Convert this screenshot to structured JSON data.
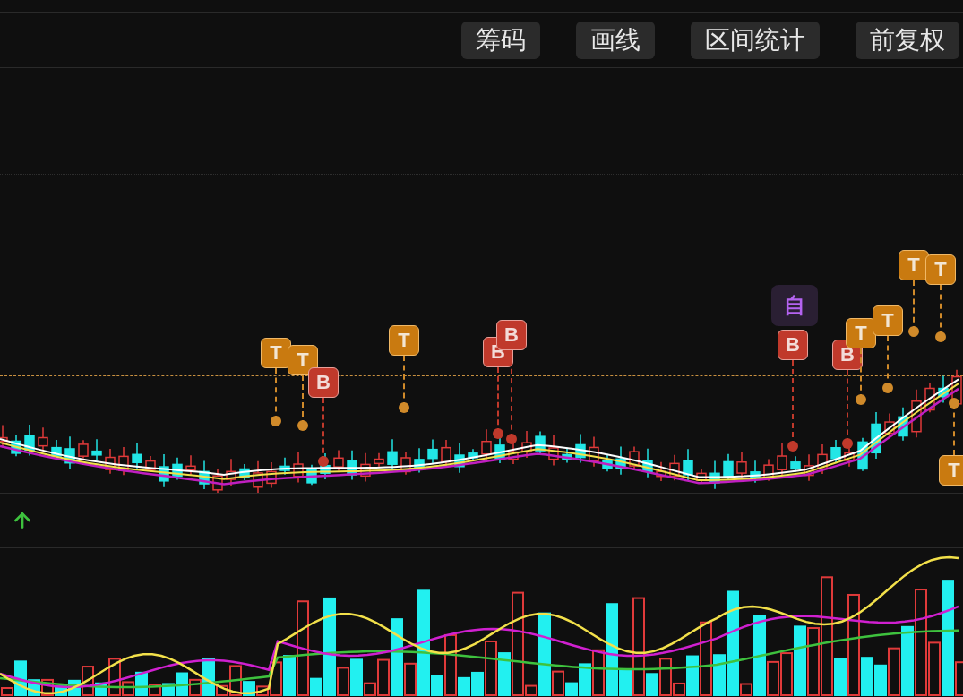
{
  "toolbar": {
    "buttons": [
      "筹码",
      "画线",
      "区间统计",
      "前复权"
    ]
  },
  "markers": [
    {
      "kind": "trade",
      "label": "T"
    },
    {
      "kind": "trade",
      "label": "T"
    },
    {
      "kind": "buy",
      "label": "B"
    },
    {
      "kind": "trade",
      "label": "T"
    },
    {
      "kind": "buy",
      "label": "B"
    },
    {
      "kind": "buy",
      "label": "B"
    },
    {
      "kind": "self",
      "label": "自"
    },
    {
      "kind": "buy",
      "label": "B"
    },
    {
      "kind": "buy",
      "label": "B"
    },
    {
      "kind": "trade",
      "label": "T"
    },
    {
      "kind": "trade",
      "label": "T"
    },
    {
      "kind": "trade",
      "label": "T"
    },
    {
      "kind": "trade",
      "label": "T"
    },
    {
      "kind": "trade",
      "label": "T"
    }
  ]
}
